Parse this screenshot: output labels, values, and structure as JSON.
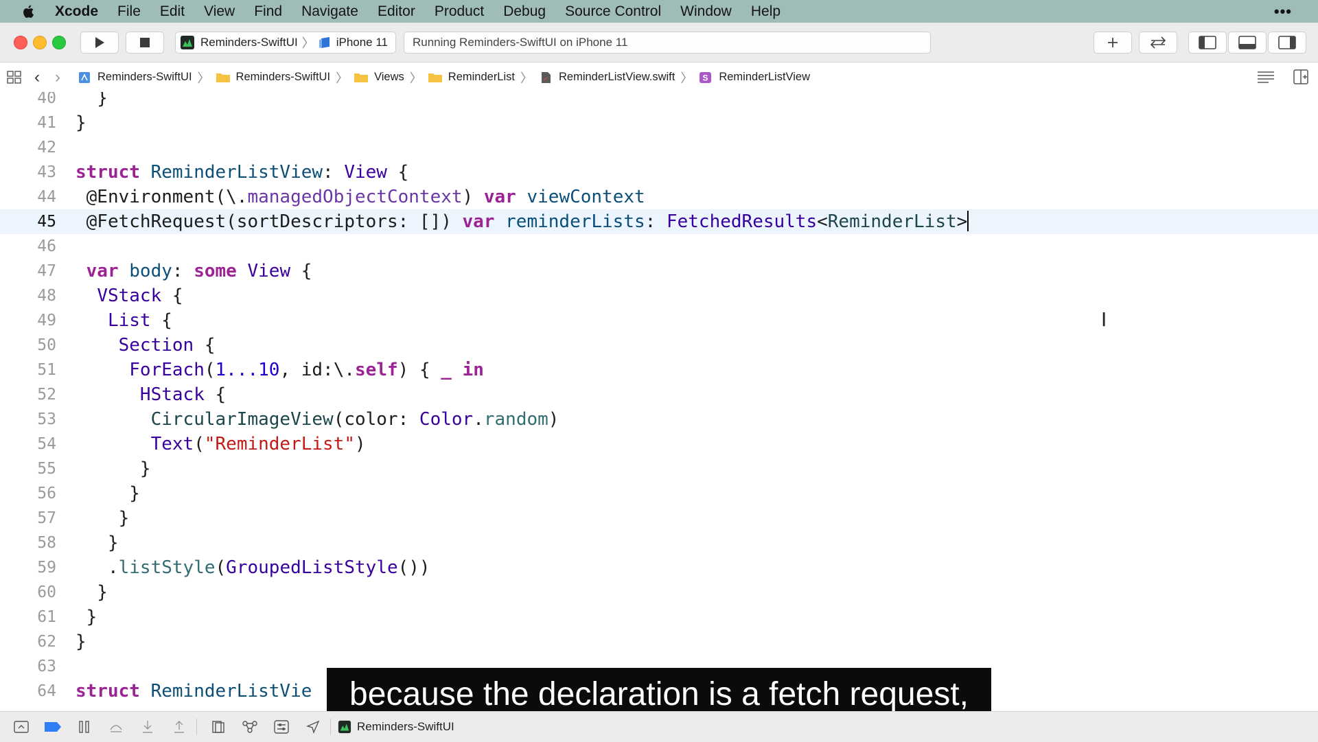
{
  "menubar": {
    "app_name": "Xcode",
    "items": [
      "File",
      "Edit",
      "View",
      "Find",
      "Navigate",
      "Editor",
      "Product",
      "Debug",
      "Source Control",
      "Window",
      "Help"
    ]
  },
  "toolbar": {
    "scheme": "Reminders-SwiftUI",
    "destination": "iPhone 11",
    "status": "Running Reminders-SwiftUI on iPhone 11"
  },
  "jumpbar": {
    "crumbs": [
      "Reminders-SwiftUI",
      "Reminders-SwiftUI",
      "Views",
      "ReminderList",
      "ReminderListView.swift",
      "ReminderListView"
    ]
  },
  "editor": {
    "current_line": "45",
    "line_numbers": [
      "40",
      "41",
      "42",
      "43",
      "44",
      "45",
      "46",
      "47",
      "48",
      "49",
      "50",
      "51",
      "52",
      "53",
      "54",
      "55",
      "56",
      "57",
      "58",
      "59",
      "60",
      "61",
      "62",
      "63",
      "64"
    ],
    "code": {
      "l40": "  }",
      "l41": "}",
      "l43_kw": "struct",
      "l43_name": "ReminderListView",
      "l43_colon": ": ",
      "l43_type": "View",
      "l43_brace": " {",
      "l44_attr": "@Environment",
      "l44_open": "(\\.",
      "l44_prop": "managedObjectContext",
      "l44_close": ") ",
      "l44_kw": "var",
      "l44_name": " viewContext",
      "l45_attr": "@FetchRequest",
      "l45_args": "(sortDescriptors: []) ",
      "l45_kw": "var",
      "l45_name": " reminderLists",
      "l45_colon": ": ",
      "l45_type": "FetchedResults",
      "l45_lt": "<",
      "l45_type2": "ReminderList",
      "l45_gt": ">",
      "l47_kw": "var",
      "l47_name": " body",
      "l47_colon": ": ",
      "l47_kw2": "some",
      "l47_type": " View",
      "l47_brace": " {",
      "l48_type": "VStack",
      "l48_brace": " {",
      "l49_type": "List",
      "l49_brace": " {",
      "l50_type": "Section",
      "l50_brace": " {",
      "l51_type": "ForEach",
      "l51_open": "(",
      "l51_range": "1...10",
      "l51_mid": ", id:\\.",
      "l51_self": "self",
      "l51_close": ") { ",
      "l51_us": "_",
      "l51_sp": " ",
      "l51_in": "in",
      "l52_type": "HStack",
      "l52_brace": " {",
      "l53_type": "CircularImageView",
      "l53_mid": "(color: ",
      "l53_type2": "Color",
      "l53_dot": ".",
      "l53_prop": "random",
      "l53_close": ")",
      "l54_type": "Text",
      "l54_open": "(",
      "l54_str": "\"ReminderList\"",
      "l54_close": ")",
      "l55": "      }",
      "l56": "     }",
      "l57": "    }",
      "l58": "   }",
      "l59_dot": "   .",
      "l59_prop": "listStyle",
      "l59_open": "(",
      "l59_type": "GroupedListStyle",
      "l59_close": "())",
      "l60": "  }",
      "l61": " }",
      "l62": "}",
      "l64_kw": "struct",
      "l64_name": " ReminderListVie"
    }
  },
  "caption": "because the declaration is a fetch request,",
  "debugbar": {
    "target": "Reminders-SwiftUI"
  }
}
